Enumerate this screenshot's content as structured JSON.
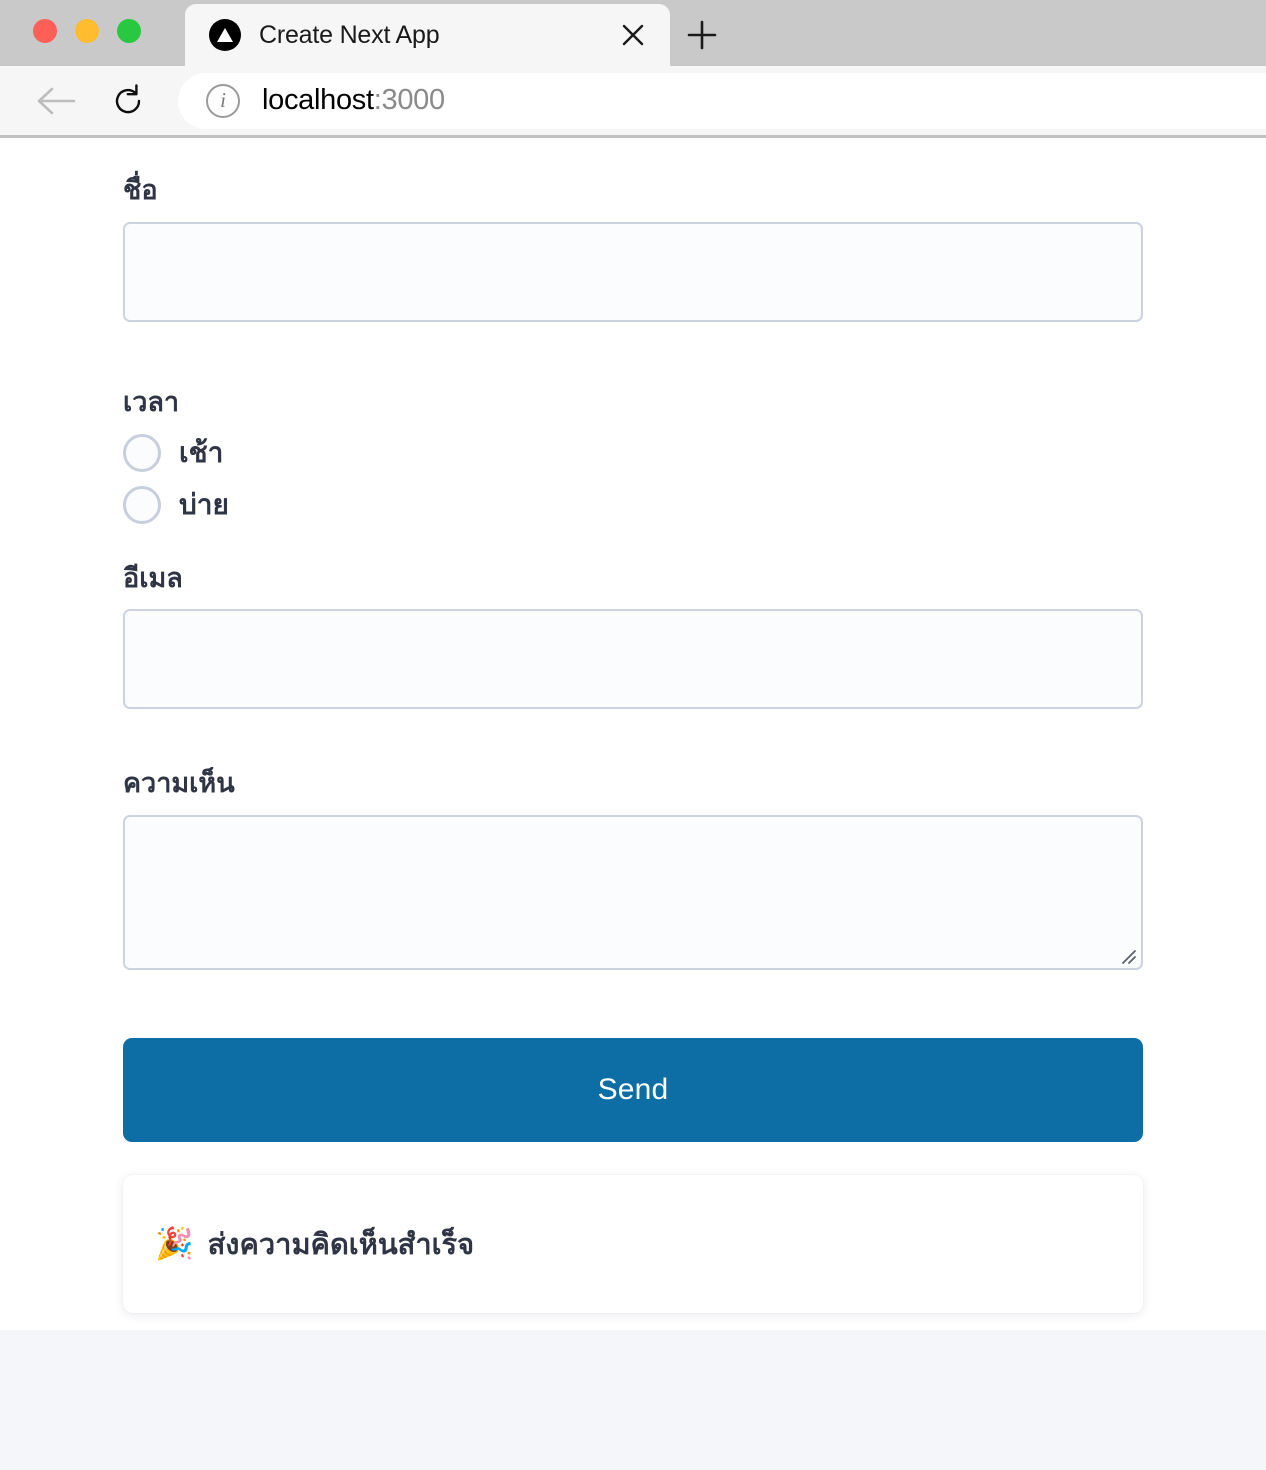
{
  "browser": {
    "window_controls": [
      {
        "name": "close",
        "color": "#ff5f57"
      },
      {
        "name": "minimize",
        "color": "#febc2e"
      },
      {
        "name": "zoom",
        "color": "#28c840"
      }
    ],
    "tab": {
      "title": "Create Next App",
      "favicon": "nextjs-triangle-icon",
      "close_icon": "close-icon"
    },
    "new_tab_icon": "plus-icon",
    "toolbar": {
      "back_icon": "arrow-left-icon",
      "reload_icon": "reload-icon",
      "info_icon": "info-circle-icon",
      "url_host": "localhost",
      "url_port": ":3000"
    }
  },
  "form": {
    "name": {
      "label": "ชื่อ",
      "value": "",
      "placeholder": ""
    },
    "time": {
      "label": "เวลา",
      "options": [
        {
          "label": "เช้า",
          "selected": false
        },
        {
          "label": "บ่าย",
          "selected": false
        }
      ]
    },
    "email": {
      "label": "อีเมล",
      "value": "",
      "placeholder": ""
    },
    "comment": {
      "label": "ความเห็น",
      "value": "",
      "placeholder": ""
    },
    "submit": {
      "label": "Send",
      "color": "#0d6ea5"
    },
    "success": {
      "emoji": "🎉",
      "message": "ส่งความคิดเห็นสำเร็จ"
    }
  },
  "colors": {
    "accent": "#0d6ea5",
    "label_text": "#2f3545",
    "input_border": "#ccd3e0",
    "input_fill": "#fbfcfd",
    "page_lower_bg": "#f4f6fa"
  }
}
